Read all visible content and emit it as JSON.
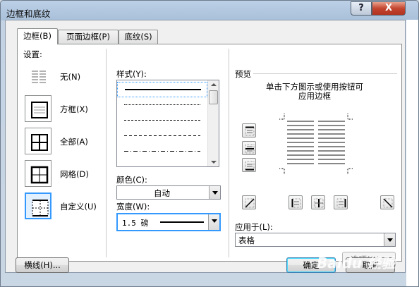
{
  "window": {
    "title": "边框和底纹",
    "help_label": "?",
    "close_label": "X"
  },
  "tabs": [
    {
      "label": "边框(B)"
    },
    {
      "label": "页面边框(P)"
    },
    {
      "label": "底纹(S)"
    }
  ],
  "settings": {
    "group_label": "设置:",
    "items": [
      {
        "label": "无(N)",
        "icon": "border-none-icon"
      },
      {
        "label": "方框(X)",
        "icon": "border-box-icon"
      },
      {
        "label": "全部(A)",
        "icon": "border-all-icon"
      },
      {
        "label": "网格(D)",
        "icon": "border-grid-icon"
      },
      {
        "label": "自定义(U)",
        "icon": "border-custom-icon",
        "selected": true
      }
    ]
  },
  "style": {
    "label": "样式(Y):",
    "options": [
      "solid",
      "dotted",
      "dashed",
      "dashed-fine",
      "dash-dot"
    ],
    "selected": "solid"
  },
  "color": {
    "label": "颜色(C):",
    "value": "自动"
  },
  "width": {
    "label": "宽度(W):",
    "value": "1.5 磅"
  },
  "preview": {
    "group_label": "预览",
    "hint_line1": "单击下方图示或使用按钮可",
    "hint_line2": "应用边框"
  },
  "apply_to": {
    "label": "应用于(L):",
    "value": "表格"
  },
  "options_button": {
    "label": "选项(O)..."
  },
  "footer": {
    "hline_button": "横线(H)...",
    "ok_button": "确定",
    "cancel_button": "取消"
  },
  "watermark": "Baidu 经验",
  "colors": {
    "accent": "#3399ff",
    "title_bar": "#bcd0e6",
    "close": "#c3452f"
  }
}
